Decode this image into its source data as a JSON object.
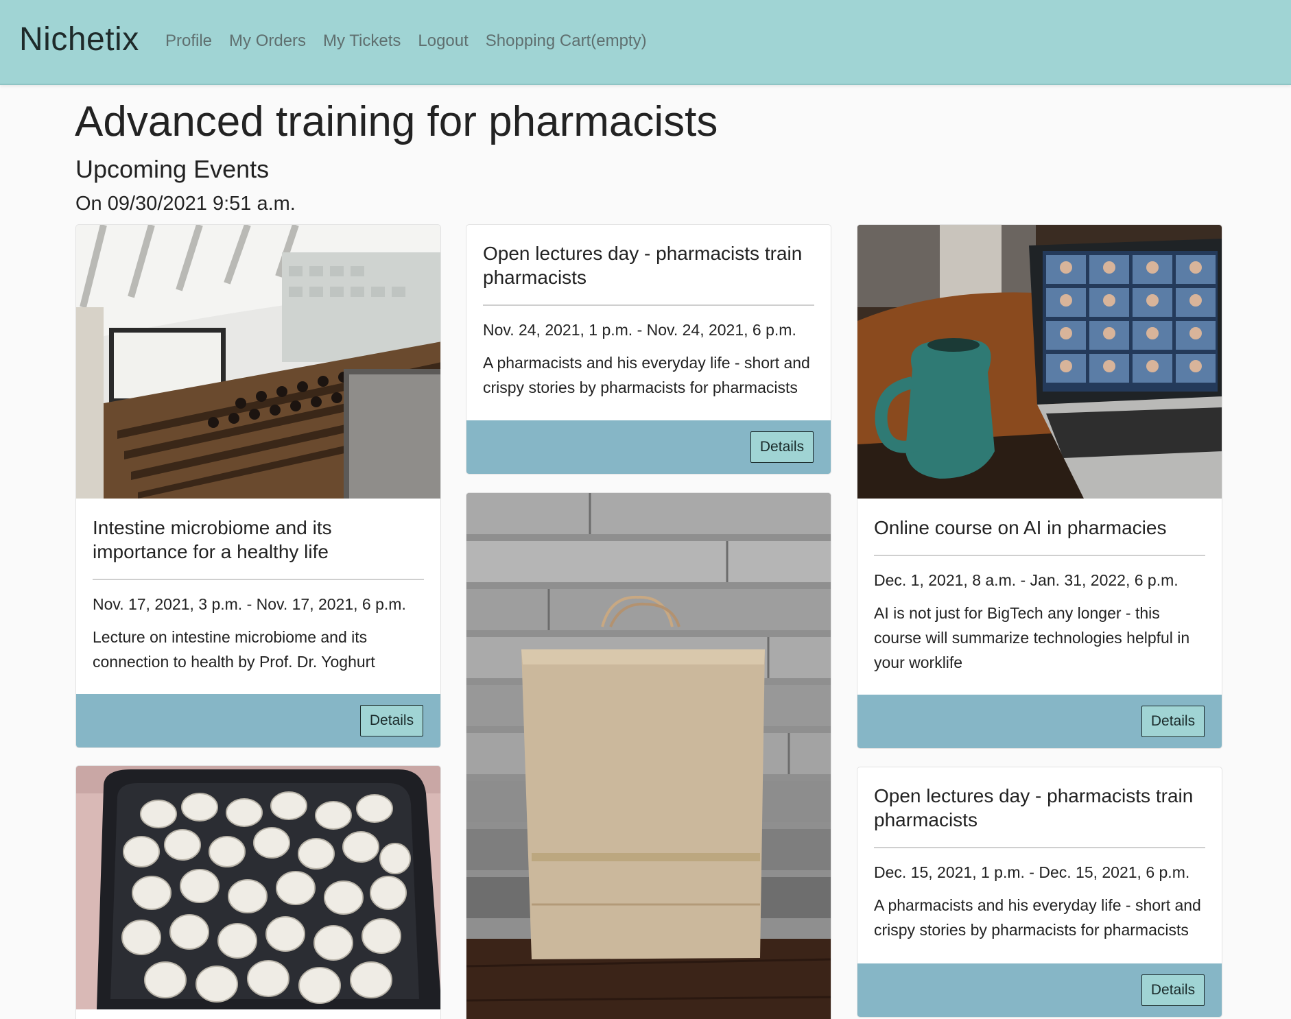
{
  "navbar": {
    "brand": "Nichetix",
    "links": [
      "Profile",
      "My Orders",
      "My Tickets",
      "Logout",
      "Shopping Cart(empty)"
    ]
  },
  "page": {
    "title": "Advanced training for pharmacists",
    "subtitle": "Upcoming Events",
    "date_line": "On 09/30/2021 9:51 a.m."
  },
  "events": [
    {
      "title": "Intestine microbiome and its importance for a healthy life",
      "dates": "Nov. 17, 2021, 3 p.m. - Nov. 17, 2021, 6 p.m.",
      "description": "Lecture on intestine microbiome and its connection to health by Prof. Dr. Yoghurt",
      "button": "Details",
      "image": "lecture-hall-photo"
    },
    {
      "title": "Open lectures day - pharmacists train pharmacists",
      "dates": "Nov. 24, 2021, 1 p.m. - Nov. 24, 2021, 6 p.m.",
      "description": "A pharmacists and his everyday life - short and crispy stories by pharmacists for pharmacists",
      "button": "Details"
    },
    {
      "title": "Online course on AI in pharmacies",
      "dates": "Dec. 1, 2021, 8 a.m. - Jan. 31, 2022, 6 p.m.",
      "description": "AI is not just for BigTech any longer - this course will summarize technologies helpful in your worklife",
      "button": "Details",
      "image": "laptop-video-call-photo"
    },
    {
      "title": "Open lectures day - pharmacists train pharmacists",
      "dates": "Dec. 15, 2021, 1 p.m. - Dec. 15, 2021, 6 p.m.",
      "description": "A pharmacists and his everyday life - short and crispy stories by pharmacists for pharmacists",
      "button": "Details"
    }
  ],
  "partial_cards": [
    {
      "image": "paper-bag-photo"
    },
    {
      "image": "pills-tin-photo"
    }
  ],
  "colors": {
    "navbar_bg": "#a0d4d4",
    "card_footer_bg": "#86b6c6",
    "button_bg": "#a0d4d4"
  }
}
